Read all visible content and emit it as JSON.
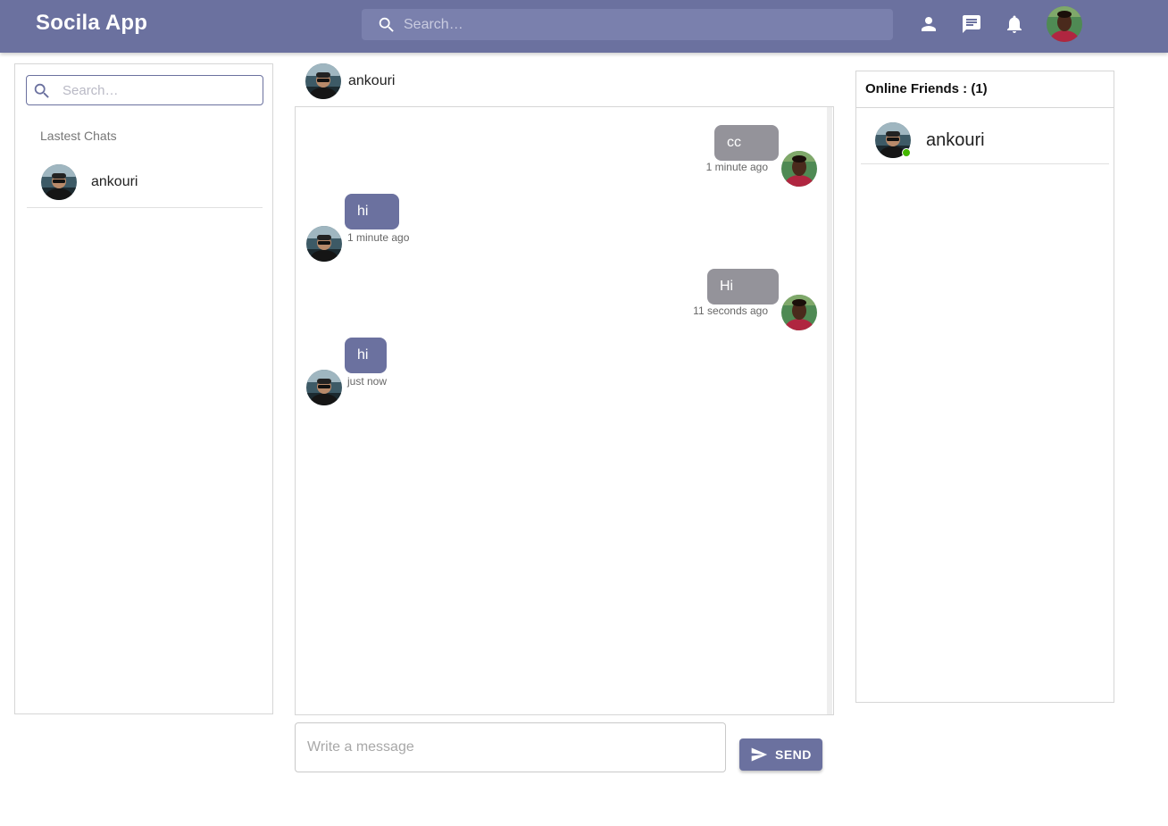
{
  "app": {
    "title": "Socila App"
  },
  "header": {
    "search_placeholder": "Search…",
    "icons": [
      "person-icon",
      "chat-icon",
      "notifications-icon"
    ]
  },
  "sidebar": {
    "search_placeholder": "Search…",
    "section_title": "Lastest Chats",
    "chats": [
      {
        "name": "ankouri"
      }
    ]
  },
  "conversation": {
    "partner_name": "ankouri",
    "messages": [
      {
        "text": "cc",
        "time": "1 minute ago",
        "direction": "outgoing"
      },
      {
        "text": "hi",
        "time": "1 minute ago",
        "direction": "incoming"
      },
      {
        "text": "Hi",
        "time": "11 seconds ago",
        "direction": "outgoing"
      },
      {
        "text": "hi",
        "time": "just now",
        "direction": "incoming"
      }
    ]
  },
  "composer": {
    "placeholder": "Write a message",
    "send_label": "SEND"
  },
  "online": {
    "title": "Online Friends : (1)",
    "friends": [
      {
        "name": "ankouri",
        "status": "online"
      }
    ]
  },
  "colors": {
    "primary": "#6b719f",
    "outgoing_bubble": "#94939a",
    "incoming_bubble": "#6b719f",
    "online_dot": "#44b700"
  }
}
